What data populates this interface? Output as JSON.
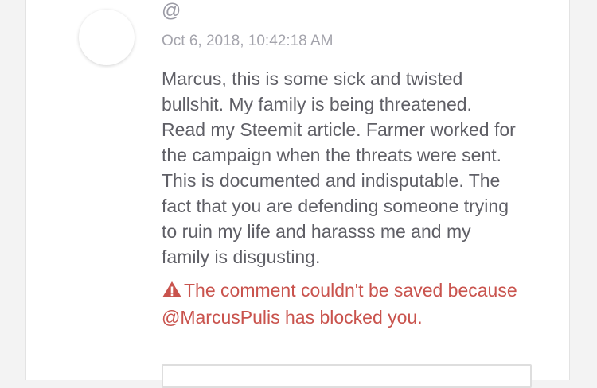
{
  "comment": {
    "username": "@",
    "timestamp": "Oct 6, 2018, 10:42:18 AM",
    "body": "Marcus, this is some sick and twisted\nbullshit. My family is being threatened.\nRead my Steemit article. Farmer worked for\nthe campaign when the threats were sent.\nThis is documented and indisputable. The\nfact that you are defending someone trying\nto ruin my life and harasss me and my\nfamily is disgusting."
  },
  "error": {
    "icon": "warning-icon",
    "message": "The comment couldn't be saved because @MarcusPulis has blocked you.",
    "color": "#c9534d"
  },
  "reply": {
    "placeholder": ""
  }
}
